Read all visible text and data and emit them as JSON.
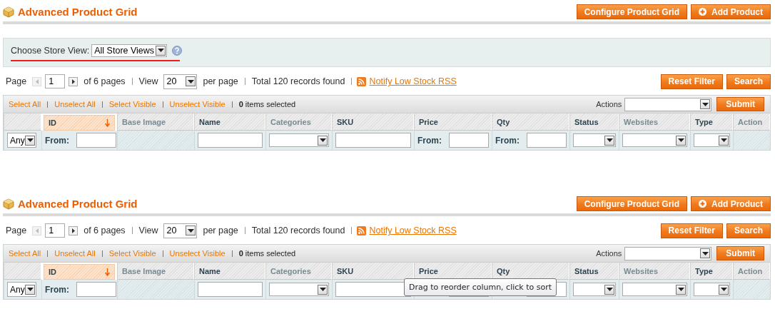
{
  "panels": [
    {
      "title": "Advanced Product Grid",
      "buttons": [
        {
          "label": "Configure Product Grid",
          "icon": false
        },
        {
          "label": "Add Product",
          "icon": true
        }
      ],
      "store_view": {
        "label": "Choose Store View:",
        "value": "All Store Views"
      },
      "pager": {
        "page_label": "Page",
        "page": "1",
        "of_pages": "of 6 pages",
        "view_label": "View",
        "per_page": "20",
        "per_page_label": "per page",
        "total": "Total 120 records found",
        "rss_link": "Notify Low Stock RSS"
      },
      "filter_buttons": [
        "Reset Filter",
        "Search"
      ],
      "massaction": {
        "links": [
          "Select All",
          "Unselect All",
          "Select Visible",
          "Unselect Visible"
        ],
        "count": "**0** items selected",
        "actions_label": "Actions",
        "submit": "Submit"
      },
      "columns": [
        {
          "kind": "massaction"
        },
        {
          "kind": "label",
          "label": "ID",
          "sortable": true,
          "sorted": true
        },
        {
          "kind": "label",
          "label": "Base Image",
          "sortable": false,
          "sorted": false
        },
        {
          "kind": "label",
          "label": "Name",
          "sortable": true,
          "sorted": false
        },
        {
          "kind": "label",
          "label": "Categories",
          "sortable": false,
          "sorted": false
        },
        {
          "kind": "label",
          "label": "SKU",
          "sortable": true,
          "sorted": false
        },
        {
          "kind": "label",
          "label": "Price",
          "sortable": true,
          "sorted": false
        },
        {
          "kind": "label",
          "label": "Qty",
          "sortable": true,
          "sorted": false
        },
        {
          "kind": "label",
          "label": "Status",
          "sortable": true,
          "sorted": false
        },
        {
          "kind": "label",
          "label": "Websites",
          "sortable": false,
          "sorted": false
        },
        {
          "kind": "label",
          "label": "Type",
          "sortable": true,
          "sorted": false
        },
        {
          "kind": "label",
          "label": "Action",
          "sortable": false,
          "sorted": false
        }
      ],
      "filters": [
        {
          "kind": "select",
          "value": "Any"
        },
        {
          "kind": "range",
          "label": "From:"
        },
        {
          "kind": "none"
        },
        {
          "kind": "text"
        },
        {
          "kind": "dropdown"
        },
        {
          "kind": "text"
        },
        {
          "kind": "range",
          "label": "From:"
        },
        {
          "kind": "range",
          "label": "From:"
        },
        {
          "kind": "dropdown"
        },
        {
          "kind": "dropdown"
        },
        {
          "kind": "dropdown"
        },
        {
          "kind": "none"
        }
      ]
    },
    {
      "title": "Advanced Product Grid",
      "buttons": [
        {
          "label": "Configure Product Grid",
          "icon": false
        },
        {
          "label": "Add Product",
          "icon": true
        }
      ],
      "pager": {
        "page_label": "Page",
        "page": "1",
        "of_pages": "of 6 pages",
        "view_label": "View",
        "per_page": "20",
        "per_page_label": "per page",
        "total": "Total 120 records found",
        "rss_link": "Notify Low Stock RSS"
      },
      "filter_buttons": [
        "Reset Filter",
        "Search"
      ],
      "massaction": {
        "links": [
          "Select All",
          "Unselect All",
          "Select Visible",
          "Unselect Visible"
        ],
        "count": "**0** items selected",
        "actions_label": "Actions",
        "submit": "Submit"
      },
      "columns": [
        {
          "kind": "massaction"
        },
        {
          "kind": "label",
          "label": "ID",
          "sortable": true,
          "sorted": true
        },
        {
          "kind": "label",
          "label": "Base Image",
          "sortable": false,
          "sorted": false
        },
        {
          "kind": "label",
          "label": "Name",
          "sortable": true,
          "sorted": false
        },
        {
          "kind": "label",
          "label": "Categories",
          "sortable": false,
          "sorted": false
        },
        {
          "kind": "label",
          "label": "SKU",
          "sortable": true,
          "sorted": false
        },
        {
          "kind": "label",
          "label": "Price",
          "sortable": true,
          "sorted": false
        },
        {
          "kind": "label",
          "label": "Qty",
          "sortable": true,
          "sorted": false
        },
        {
          "kind": "label",
          "label": "Status",
          "sortable": true,
          "sorted": false
        },
        {
          "kind": "label",
          "label": "Websites",
          "sortable": false,
          "sorted": false
        },
        {
          "kind": "label",
          "label": "Type",
          "sortable": true,
          "sorted": false
        },
        {
          "kind": "label",
          "label": "Action",
          "sortable": false,
          "sorted": false
        }
      ],
      "filters": [
        {
          "kind": "select",
          "value": "Any"
        },
        {
          "kind": "range",
          "label": "From:"
        },
        {
          "kind": "none"
        },
        {
          "kind": "text"
        },
        {
          "kind": "dropdown"
        },
        {
          "kind": "text"
        },
        {
          "kind": "range"
        },
        {
          "kind": "range"
        },
        {
          "kind": "dropdown"
        },
        {
          "kind": "dropdown"
        },
        {
          "kind": "dropdown"
        },
        {
          "kind": "none"
        }
      ],
      "tooltip": "Drag to reorder column, click to sort"
    }
  ]
}
